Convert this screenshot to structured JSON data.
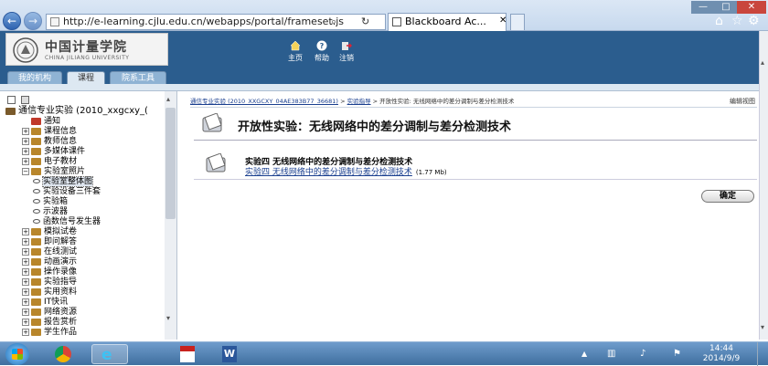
{
  "browser": {
    "url": "http://e-learning.cjlu.edu.cn/webapps/portal/frameset.js",
    "tab_title": "Blackboard Ac...",
    "window_controls": [
      "—",
      "□",
      "✕"
    ]
  },
  "header": {
    "logo_cn": "中国计量学院",
    "logo_en": "CHINA JILIANG UNIVERSITY",
    "links": [
      {
        "label": "主页",
        "icon": "home-icon"
      },
      {
        "label": "帮助",
        "icon": "help-icon"
      },
      {
        "label": "注销",
        "icon": "logout-icon"
      }
    ],
    "tabs": [
      {
        "label": "我的机构"
      },
      {
        "label": "课程"
      },
      {
        "label": "院系工具"
      }
    ],
    "collapse_label": "编辑视图"
  },
  "tree": {
    "root_label": "通信专业实验 (2010_xxgcxy_(",
    "items": [
      {
        "label": "通知",
        "level": 1,
        "expand": ""
      },
      {
        "label": "课程信息",
        "level": 1,
        "expand": "+"
      },
      {
        "label": "教师信息",
        "level": 1,
        "expand": "+"
      },
      {
        "label": "多媒体课件",
        "level": 1,
        "expand": "+"
      },
      {
        "label": "电子教材",
        "level": 1,
        "expand": "+"
      },
      {
        "label": "实验室照片",
        "level": 1,
        "expand": "−"
      },
      {
        "label": "实验室整体图",
        "level": 2,
        "expand": ""
      },
      {
        "label": "实验设备三件套",
        "level": 2,
        "expand": ""
      },
      {
        "label": "实验箱",
        "level": 2,
        "expand": ""
      },
      {
        "label": "示波器",
        "level": 2,
        "expand": ""
      },
      {
        "label": "函数信号发生器",
        "level": 2,
        "expand": ""
      },
      {
        "label": "模拟试卷",
        "level": 1,
        "expand": "+"
      },
      {
        "label": "即问解答",
        "level": 1,
        "expand": "+"
      },
      {
        "label": "在线测试",
        "level": 1,
        "expand": "+"
      },
      {
        "label": "动画演示",
        "level": 1,
        "expand": "+"
      },
      {
        "label": "操作录像",
        "level": 1,
        "expand": "+"
      },
      {
        "label": "实验指导",
        "level": 1,
        "expand": "+"
      },
      {
        "label": "实用资料",
        "level": 1,
        "expand": "+"
      },
      {
        "label": "IT快讯",
        "level": 1,
        "expand": "+"
      },
      {
        "label": "网络资源",
        "level": 1,
        "expand": "+"
      },
      {
        "label": "报告赏析",
        "level": 1,
        "expand": "+"
      },
      {
        "label": "学生作品",
        "level": 1,
        "expand": "+"
      }
    ]
  },
  "main": {
    "breadcrumb": {
      "course": "通信专业实验 (2010_XXGCXY_04AE383B77_36681)",
      "section": "实验指导",
      "current": "开放性实验: 无线网络中的差分调制与差分检测技术"
    },
    "title": "开放性实验：无线网络中的差分调制与差分检测技术",
    "item_title": "实验四 无线网络中的差分调制与差分检测技术",
    "file_link": "实验四 无线网络中的差分调制与差分检测技术",
    "file_size": "(1.77 Mb)",
    "ok_label": "确定"
  },
  "taskbar": {
    "time": "14:44",
    "date": "2014/9/9"
  },
  "colors": {
    "header_blue": "#2b5d8e",
    "link_blue": "#1a3f8f",
    "taskbar_blue": "#3f6f9f"
  }
}
